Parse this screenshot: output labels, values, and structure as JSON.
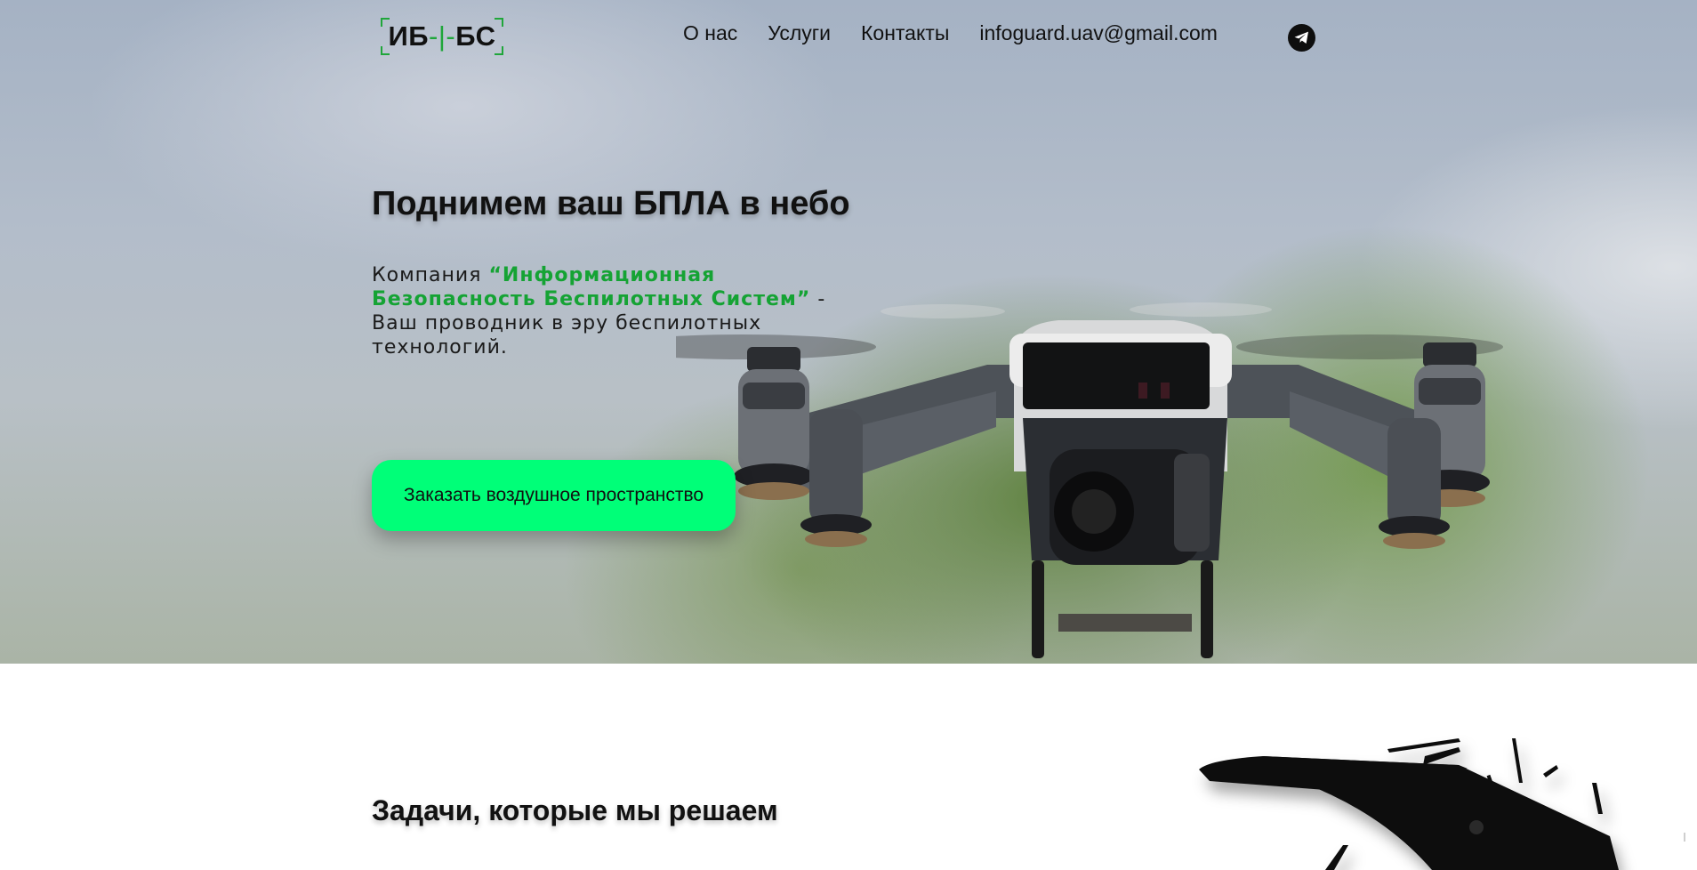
{
  "header": {
    "logo": {
      "left": "ИБ",
      "cross": "-|-",
      "right": "БС"
    },
    "nav": [
      {
        "label": "О нас"
      },
      {
        "label": "Услуги"
      },
      {
        "label": "Контакты"
      },
      {
        "label": "infoguard.uav@gmail.com"
      }
    ],
    "social_icon": "telegram-icon"
  },
  "hero": {
    "title": "Поднимем ваш БПЛА в небо",
    "desc_prefix": "Компания ",
    "desc_company": "“Информационная Безопасность Беспилотных Систем”",
    "desc_suffix": " - Ваш проводник в эру беспилотных технологий.",
    "cta_label": "Заказать воздушное пространство",
    "image": "quadcopter-drone-photo"
  },
  "tasks_section": {
    "title": "Задачи, которые мы решаем",
    "image": "vtol-drone-silhouette"
  },
  "colors": {
    "accent_green": "#00ff78",
    "text_green": "#15a334",
    "dark": "#111111"
  }
}
